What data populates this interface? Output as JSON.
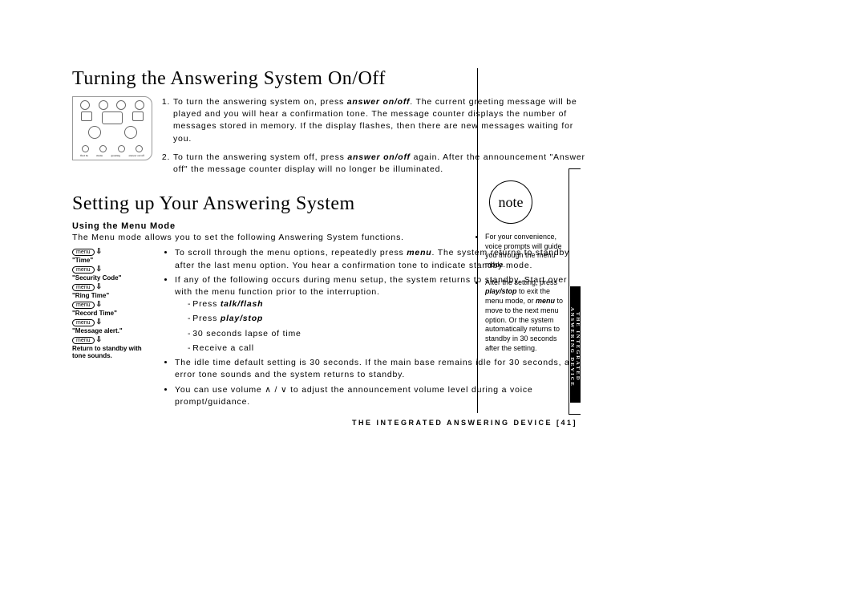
{
  "section1": {
    "heading": "Turning the Answering System On/Off",
    "items": [
      {
        "pre": "To turn the answering system on, press ",
        "bold": "answer on/off",
        "post": ". The current greeting message will be played and you will hear a confirmation tone. The message counter displays the number of messages stored in memory. If the display flashes, then there are new messages waiting for you."
      },
      {
        "pre": "To turn the answering system off, press ",
        "bold": "answer on/off",
        "post": " again. After the announcement \"Answer off\" the message counter display will no longer be illuminated."
      }
    ]
  },
  "section2": {
    "heading": "Setting up Your Answering System",
    "subhead": "Using the Menu Mode",
    "intro": "The Menu mode allows you to set the following Answering System functions.",
    "menuflow": {
      "chip": "menu",
      "steps": [
        "\"Time\"",
        "\"Security Code\"",
        "\"Ring Time\"",
        "\"Record Time\"",
        "\"Message alert.\""
      ],
      "final": "Return to standby with tone sounds."
    },
    "bullets": {
      "b1a": "To scroll through the menu options, repeatedly press ",
      "b1bold": "menu",
      "b1b": ". The system returns to standby after the last menu option. You hear a confirmation tone to indicate standby mode.",
      "b2": "If any of the following occurs during menu setup, the system returns to standby. Start over with the menu function prior to the interruption.",
      "sub": {
        "s1a": "Press ",
        "s1b": "talk/flash",
        "s2a": "Press ",
        "s2b": "play/stop",
        "s3": "30 seconds lapse of time",
        "s4": "Receive a call"
      },
      "b3": "The idle time default setting is 30 seconds. If the main base remains idle for 30 seconds, an error tone sounds and the system returns to standby.",
      "b4a": "You can use volume ",
      "b4b": " to adjust the announcement volume level during a voice prompt/guidance."
    }
  },
  "note": {
    "label": "note",
    "items": [
      "For your convenience, voice prompts will guide you through the menu mode.",
      {
        "pre": "After the setting, press ",
        "b1": "play/stop",
        "mid1": " to exit the menu mode, or ",
        "b2": "menu",
        "mid2": " to move to the next menu option. Or the system automatically returns to standby in 30 seconds after the setting."
      }
    ]
  },
  "footer": "THE INTEGRATED ANSWERING DEVICE   [41]",
  "sidetab": "THE INTEGRATED ANSWERING DEVICE",
  "panel_labels": [
    "find hs",
    "menu",
    "greeting",
    "answer on/off"
  ]
}
